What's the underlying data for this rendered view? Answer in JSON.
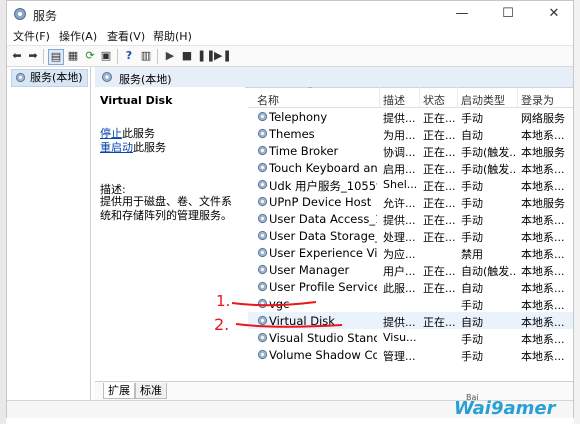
{
  "window": {
    "title": "服务"
  },
  "menu": [
    "文件(F)",
    "操作(A)",
    "查看(V)",
    "帮助(H)"
  ],
  "tree": {
    "root": "服务(本地)"
  },
  "content": {
    "header": "服务(本地)"
  },
  "detail": {
    "service_name": "Virtual Disk",
    "stop_link": "停止",
    "stop_suffix": "此服务",
    "restart_link": "重启动",
    "restart_suffix": "此服务",
    "desc_label": "描述:",
    "desc_text": "提供用于磁盘、卷、文件系统和存储阵列的管理服务。"
  },
  "table": {
    "columns": [
      "名称",
      "描述",
      "状态",
      "启动类型",
      "登录为"
    ],
    "rows": [
      [
        "Telephony",
        "提供...",
        "正在...",
        "手动",
        "网络服务"
      ],
      [
        "Themes",
        "为用...",
        "正在...",
        "自动",
        "本地系..."
      ],
      [
        "Time Broker",
        "协调...",
        "正在...",
        "手动(触发...",
        "本地服务"
      ],
      [
        "Touch Keyboard an...",
        "启用...",
        "正在...",
        "手动(触发...",
        "本地系..."
      ],
      [
        "Udk 用户服务_1055f6",
        "Shel...",
        "正在...",
        "手动",
        "本地系..."
      ],
      [
        "UPnP Device Host",
        "允许...",
        "正在...",
        "手动",
        "本地服务"
      ],
      [
        "User Data Access_1...",
        "提供...",
        "正在...",
        "手动",
        "本地系..."
      ],
      [
        "User Data Storage_...",
        "处理...",
        "正在...",
        "手动",
        "本地系..."
      ],
      [
        "User Experience Vir...",
        "为应...",
        "",
        "禁用",
        "本地系..."
      ],
      [
        "User Manager",
        "用户...",
        "正在...",
        "自动(触发...",
        "本地系..."
      ],
      [
        "User Profile Service",
        "此服...",
        "正在...",
        "自动",
        "本地系..."
      ],
      [
        "vgc",
        "",
        "",
        "手动",
        "本地系..."
      ],
      [
        "Virtual Disk",
        "提供...",
        "正在...",
        "自动",
        "本地系..."
      ],
      [
        "Visual Studio Stand...",
        "Visu...",
        "",
        "手动",
        "本地系..."
      ],
      [
        "Volume Shadow Co...",
        "管理...",
        "",
        "手动",
        "本地系..."
      ]
    ],
    "selected_index": 12
  },
  "tabs": [
    "扩展",
    "标准"
  ],
  "annotations": {
    "mark1": "1.",
    "mark2": "2.",
    "color": "#e8181c"
  },
  "watermark": {
    "left": "Bai",
    "right": "Wai9amer"
  },
  "colors": {
    "link": "#0645ad",
    "header_bg": "#e6eef8",
    "selected": "#d9e7f5"
  }
}
